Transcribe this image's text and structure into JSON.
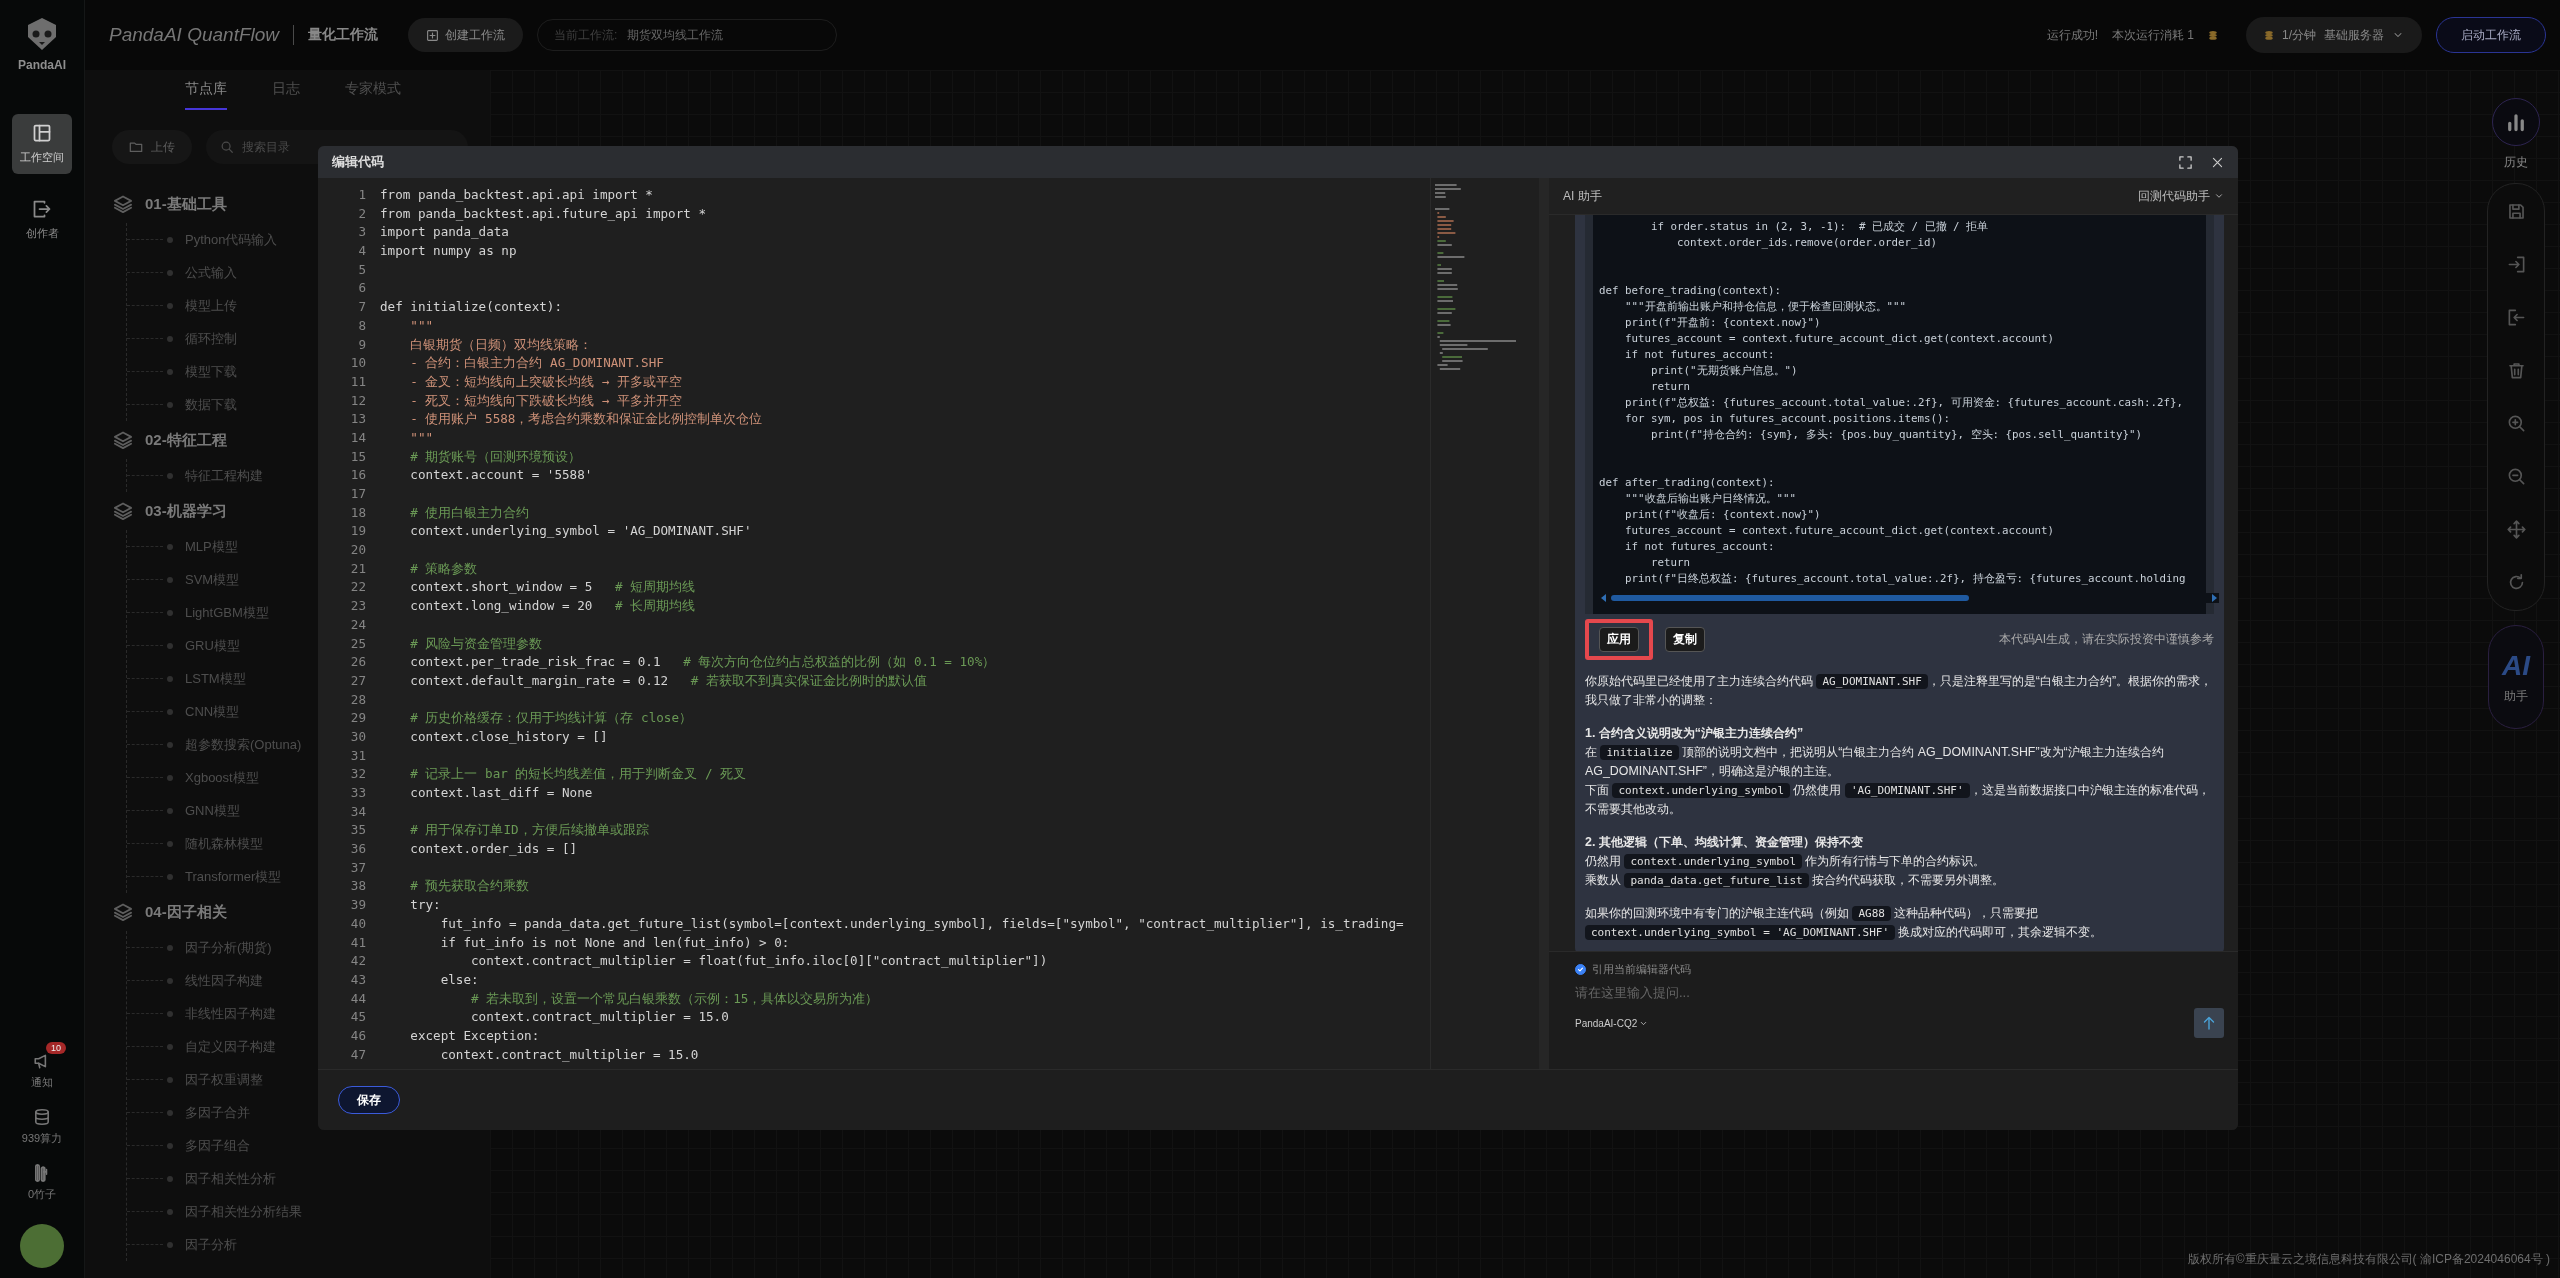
{
  "rail": {
    "logo": "PandaAI",
    "items": [
      {
        "label": "工作空间",
        "selected": true
      },
      {
        "label": "创作者",
        "selected": false
      }
    ],
    "bottom": [
      {
        "kind": "notify",
        "label": "通知",
        "badge": "10"
      },
      {
        "kind": "power",
        "label": "939算力"
      },
      {
        "kind": "bamboo",
        "label": "0竹子"
      }
    ]
  },
  "topbar": {
    "brand": "PandaAI QuantFlow",
    "subtitle": "量化工作流",
    "create_button": "创建工作流",
    "current": {
      "label": "当前工作流:",
      "value": "期货双均线工作流"
    },
    "status": [
      "运行成功!",
      "本次运行消耗 1"
    ],
    "server": {
      "rate": "1/分钟",
      "name": "基础服务器"
    },
    "start_button": "启动工作流"
  },
  "node_panel": {
    "tabs": [
      {
        "label": "节点库",
        "selected": true
      },
      {
        "label": "日志",
        "selected": false
      },
      {
        "label": "专家模式",
        "selected": false
      }
    ],
    "upload_button": "上传",
    "search": {
      "placeholder": "搜索目录"
    },
    "groups": [
      {
        "label": "01-基础工具",
        "children": [
          {
            "label": "Python代码输入"
          },
          {
            "label": "公式输入"
          },
          {
            "label": "模型上传"
          },
          {
            "label": "循环控制"
          },
          {
            "label": "模型下载"
          },
          {
            "label": "数据下载"
          }
        ]
      },
      {
        "label": "02-特征工程",
        "children": [
          {
            "label": "特征工程构建"
          }
        ]
      },
      {
        "label": "03-机器学习",
        "children": [
          {
            "label": "MLP模型"
          },
          {
            "label": "SVM模型"
          },
          {
            "label": "LightGBM模型"
          },
          {
            "label": "GRU模型"
          },
          {
            "label": "LSTM模型"
          },
          {
            "label": "CNN模型"
          },
          {
            "label": "超参数搜索(Optuna)"
          },
          {
            "label": "Xgboost模型"
          },
          {
            "label": "GNN模型"
          },
          {
            "label": "随机森林模型"
          },
          {
            "label": "Transformer模型"
          }
        ]
      },
      {
        "label": "04-因子相关",
        "children": [
          {
            "label": "因子分析(期货)"
          },
          {
            "label": "线性因子构建"
          },
          {
            "label": "非线性因子构建"
          },
          {
            "label": "自定义因子构建"
          },
          {
            "label": "因子权重调整"
          },
          {
            "label": "多因子合并"
          },
          {
            "label": "多因子组合"
          },
          {
            "label": "因子相关性分析"
          },
          {
            "label": "因子相关性分析结果"
          },
          {
            "label": "因子分析"
          }
        ]
      }
    ]
  },
  "right_rail": {
    "history": "历史",
    "ai": {
      "mark": "AI",
      "label": "助手"
    }
  },
  "modal": {
    "title": "编辑代码",
    "code": [
      {
        "n": "1",
        "kind": "code",
        "text": "from panda_backtest.api.api import *"
      },
      {
        "n": "2",
        "kind": "code",
        "text": "from panda_backtest.api.future_api import *"
      },
      {
        "n": "3",
        "kind": "code",
        "text": "import panda_data"
      },
      {
        "n": "4",
        "kind": "code",
        "text": "import numpy as np"
      },
      {
        "n": "5"
      },
      {
        "n": "6"
      },
      {
        "n": "7",
        "kind": "code",
        "text": "def initialize(context):"
      },
      {
        "n": "8",
        "kind": "doc",
        "text": "    \"\"\""
      },
      {
        "n": "9",
        "kind": "doc",
        "text": "    白银期货（日频）双均线策略："
      },
      {
        "n": "10",
        "kind": "doc",
        "text": "    - 合约：白银主力合约 AG_DOMINANT.SHF"
      },
      {
        "n": "11",
        "kind": "doc",
        "text": "    - 金叉：短均线向上突破长均线 → 开多或平空"
      },
      {
        "n": "12",
        "kind": "doc",
        "text": "    - 死叉：短均线向下跌破长均线 → 平多并开空"
      },
      {
        "n": "13",
        "kind": "doc",
        "text": "    - 使用账户 5588，考虑合约乘数和保证金比例控制单次仓位"
      },
      {
        "n": "14",
        "kind": "doc",
        "text": "    \"\"\""
      },
      {
        "n": "15",
        "kind": "comment",
        "text": "    # 期货账号（回测环境预设）"
      },
      {
        "n": "16",
        "kind": "code",
        "text": "    context.account = '5588'"
      },
      {
        "n": "17"
      },
      {
        "n": "18",
        "kind": "comment",
        "text": "    # 使用白银主力合约"
      },
      {
        "n": "19",
        "kind": "code",
        "text": "    context.underlying_symbol = 'AG_DOMINANT.SHF'"
      },
      {
        "n": "20"
      },
      {
        "n": "21",
        "kind": "comment",
        "text": "    # 策略参数"
      },
      {
        "n": "22",
        "kind": "code",
        "text": "    context.short_window = 5",
        "comment": "# 短周期均线"
      },
      {
        "n": "23",
        "kind": "code",
        "text": "    context.long_window = 20",
        "comment": "# 长周期均线"
      },
      {
        "n": "24"
      },
      {
        "n": "25",
        "kind": "comment",
        "text": "    # 风险与资金管理参数"
      },
      {
        "n": "26",
        "kind": "code",
        "text": "    context.per_trade_risk_frac = 0.1",
        "comment": "# 每次方向仓位约占总权益的比例（如 0.1 = 10%）"
      },
      {
        "n": "27",
        "kind": "code",
        "text": "    context.default_margin_rate = 0.12",
        "comment": "# 若获取不到真实保证金比例时的默认值"
      },
      {
        "n": "28"
      },
      {
        "n": "29",
        "kind": "comment",
        "text": "    # 历史价格缓存：仅用于均线计算（存 close）"
      },
      {
        "n": "30",
        "kind": "code",
        "text": "    context.close_history = []"
      },
      {
        "n": "31"
      },
      {
        "n": "32",
        "kind": "comment",
        "text": "    # 记录上一 bar 的短长均线差值，用于判断金叉 / 死叉"
      },
      {
        "n": "33",
        "kind": "code",
        "text": "    context.last_diff = None"
      },
      {
        "n": "34"
      },
      {
        "n": "35",
        "kind": "comment",
        "text": "    # 用于保存订单ID，方便后续撤单或跟踪"
      },
      {
        "n": "36",
        "kind": "code",
        "text": "    context.order_ids = []"
      },
      {
        "n": "37"
      },
      {
        "n": "38",
        "kind": "comment",
        "text": "    # 预先获取合约乘数"
      },
      {
        "n": "39",
        "kind": "code",
        "text": "    try:"
      },
      {
        "n": "40",
        "kind": "code",
        "text": "        fut_info = panda_data.get_future_list(symbol=[context.underlying_symbol], fields=[\"symbol\", \"contract_multiplier\"], is_trading="
      },
      {
        "n": "41",
        "kind": "code",
        "text": "        if fut_info is not None and len(fut_info) > 0:"
      },
      {
        "n": "42",
        "kind": "code",
        "text": "            context.contract_multiplier = float(fut_info.iloc[0][\"contract_multiplier\"])"
      },
      {
        "n": "43",
        "kind": "code",
        "text": "        else:"
      },
      {
        "n": "44",
        "kind": "comment",
        "text": "            # 若未取到，设置一个常见白银乘数（示例：15，具体以交易所为准）"
      },
      {
        "n": "45",
        "kind": "code",
        "text": "            context.contract_multiplier = 15.0"
      },
      {
        "n": "46",
        "kind": "code",
        "text": "    except Exception:"
      },
      {
        "n": "47",
        "kind": "code",
        "text": "        context.contract_multiplier = 15.0"
      }
    ],
    "ai": {
      "title": "AI 助手",
      "mode": "回测代码助手",
      "code_blocks": [
        [
          "        if order.status in (2, 3, -1):  # 已成交 / 已撤 / 拒单",
          "            context.order_ids.remove(order.order_id)"
        ],
        [
          "def before_trading(context):",
          "    \"\"\"开盘前输出账户和持仓信息，便于检查回测状态。\"\"\"",
          "    print(f\"开盘前: {context.now}\")",
          "    futures_account = context.future_account_dict.get(context.account)",
          "    if not futures_account:",
          "        print(\"无期货账户信息。\")",
          "        return",
          "    print(f\"总权益: {futures_account.total_value:.2f}, 可用资金: {futures_account.cash:.2f},",
          "    for sym, pos in futures_account.positions.items():",
          "        print(f\"持仓合约: {sym}, 多头: {pos.buy_quantity}, 空头: {pos.sell_quantity}\")"
        ],
        [
          "def after_trading(context):",
          "    \"\"\"收盘后输出账户日终情况。\"\"\"",
          "    print(f\"收盘后: {context.now}\")",
          "    futures_account = context.future_account_dict.get(context.account)",
          "    if not futures_account:",
          "        return",
          "    print(f\"日终总权益: {futures_account.total_value:.2f}, 持仓盈亏: {futures_account.holding"
        ]
      ],
      "actions": [
        {
          "label": "应用",
          "highlighted": true
        },
        {
          "label": "复制",
          "highlighted": false
        }
      ],
      "note": "本代码AI生成，请在实际投资中谨慎参考",
      "sections": [
        [
          {
            "kind": "text",
            "parts": [
              {
                "text": "你原始代码里已经使用了主力连续合约代码 "
              },
              {
                "code": "AG_DOMINANT.SHF"
              },
              {
                "text": "，只是注释里写的是“白银主力合约”。根据你的需求，我只做了非常小的调整："
              }
            ]
          }
        ],
        [
          {
            "kind": "heading",
            "parts": [
              {
                "text": "1. 合约含义说明改为“沪银主力连续合约”"
              }
            ]
          },
          {
            "kind": "text",
            "parts": [
              {
                "text": "在 "
              },
              {
                "code": "initialize"
              },
              {
                "text": " 顶部的说明文档中，把说明从“白银主力合约 AG_DOMINANT.SHF”改为“沪银主力连续合约 AG_DOMINANT.SHF”，明确这是沪银的主连。"
              }
            ]
          },
          {
            "kind": "text",
            "parts": [
              {
                "text": "下面 "
              },
              {
                "code": "context.underlying_symbol"
              },
              {
                "text": " 仍然使用 "
              },
              {
                "code": "'AG_DOMINANT.SHF'"
              },
              {
                "text": "，这是当前数据接口中沪银主连的标准代码，不需要其他改动。"
              }
            ]
          }
        ],
        [
          {
            "kind": "heading",
            "parts": [
              {
                "text": "2. 其他逻辑（下单、均线计算、资金管理）保持不变"
              }
            ]
          },
          {
            "kind": "text",
            "parts": [
              {
                "text": "仍然用 "
              },
              {
                "code": "context.underlying_symbol"
              },
              {
                "text": " 作为所有行情与下单的合约标识。"
              }
            ]
          },
          {
            "kind": "text",
            "parts": [
              {
                "text": "乘数从 "
              },
              {
                "code": "panda_data.get_future_list"
              },
              {
                "text": " 按合约代码获取，不需要另外调整。"
              }
            ]
          }
        ],
        [
          {
            "kind": "text",
            "parts": [
              {
                "text": "如果你的回测环境中有专门的沪银主连代码（例如 "
              },
              {
                "code": "AG88"
              },
              {
                "text": " 这种品种代码），只需要把 "
              },
              {
                "code": "context.underlying_symbol = 'AG_DOMINANT.SHF'"
              },
              {
                "text": " 换成对应的代码即可，其余逻辑不变。"
              }
            ]
          }
        ]
      ],
      "quote": {
        "label": "引用当前编辑器代码",
        "checked": true
      },
      "input": {
        "placeholder": "请在这里输入提问..."
      },
      "model": "PandaAI-CQ2"
    },
    "save_button": "保存"
  },
  "copyright": "版权所有©重庆量云之境信息科技有限公司( 渝ICP备2024046064号 )"
}
